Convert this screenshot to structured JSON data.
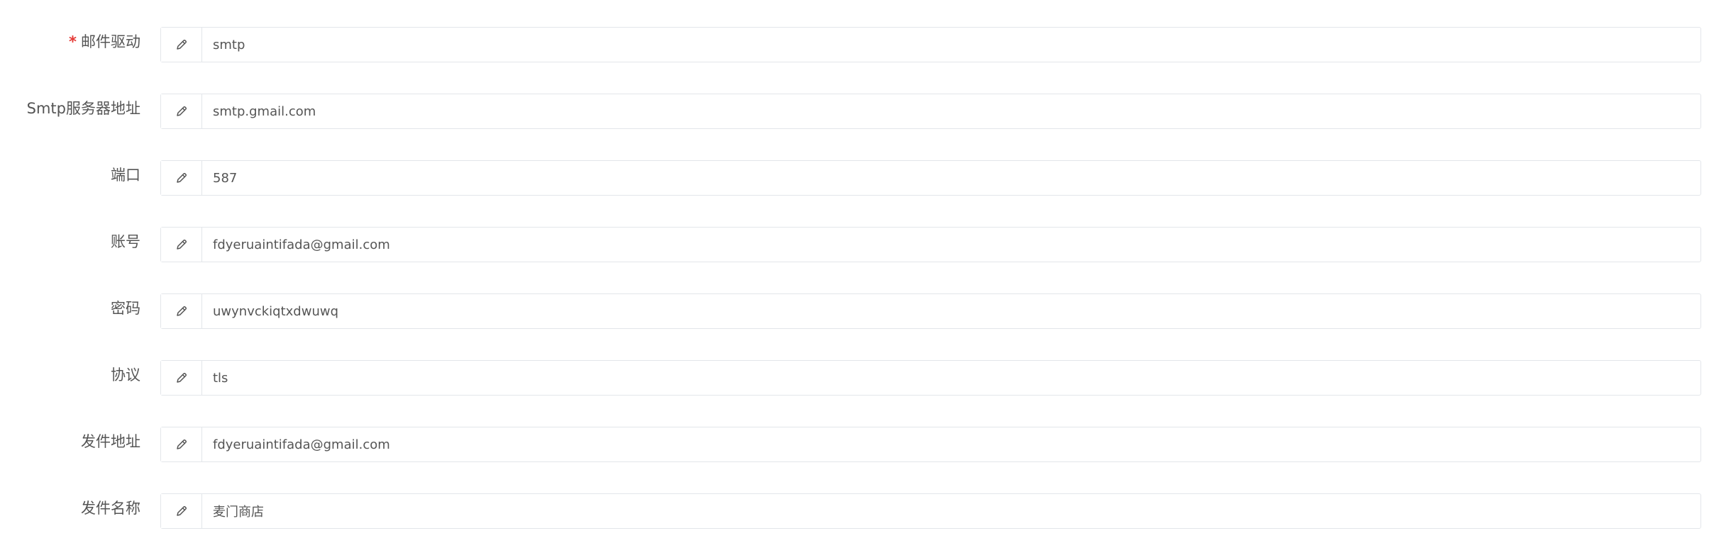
{
  "form": {
    "fields": [
      {
        "label": "邮件驱动",
        "required": true,
        "required_mark": "*",
        "value": "smtp",
        "icon": "pencil-icon"
      },
      {
        "label": "Smtp服务器地址",
        "required": false,
        "value": "smtp.gmail.com",
        "icon": "pencil-icon"
      },
      {
        "label": "端口",
        "required": false,
        "value": "587",
        "icon": "pencil-icon"
      },
      {
        "label": "账号",
        "required": false,
        "value": "fdyeruaintifada@gmail.com",
        "icon": "pencil-icon"
      },
      {
        "label": "密码",
        "required": false,
        "value": "uwynvckiqtxdwuwq",
        "icon": "pencil-icon"
      },
      {
        "label": "协议",
        "required": false,
        "value": "tls",
        "icon": "pencil-icon"
      },
      {
        "label": "发件地址",
        "required": false,
        "value": "fdyeruaintifada@gmail.com",
        "icon": "pencil-icon"
      },
      {
        "label": "发件名称",
        "required": false,
        "value": "麦门商店",
        "icon": "pencil-icon"
      }
    ]
  },
  "colors": {
    "required_mark": "#e53935",
    "border": "#e3e6ea",
    "text": "#555555"
  }
}
